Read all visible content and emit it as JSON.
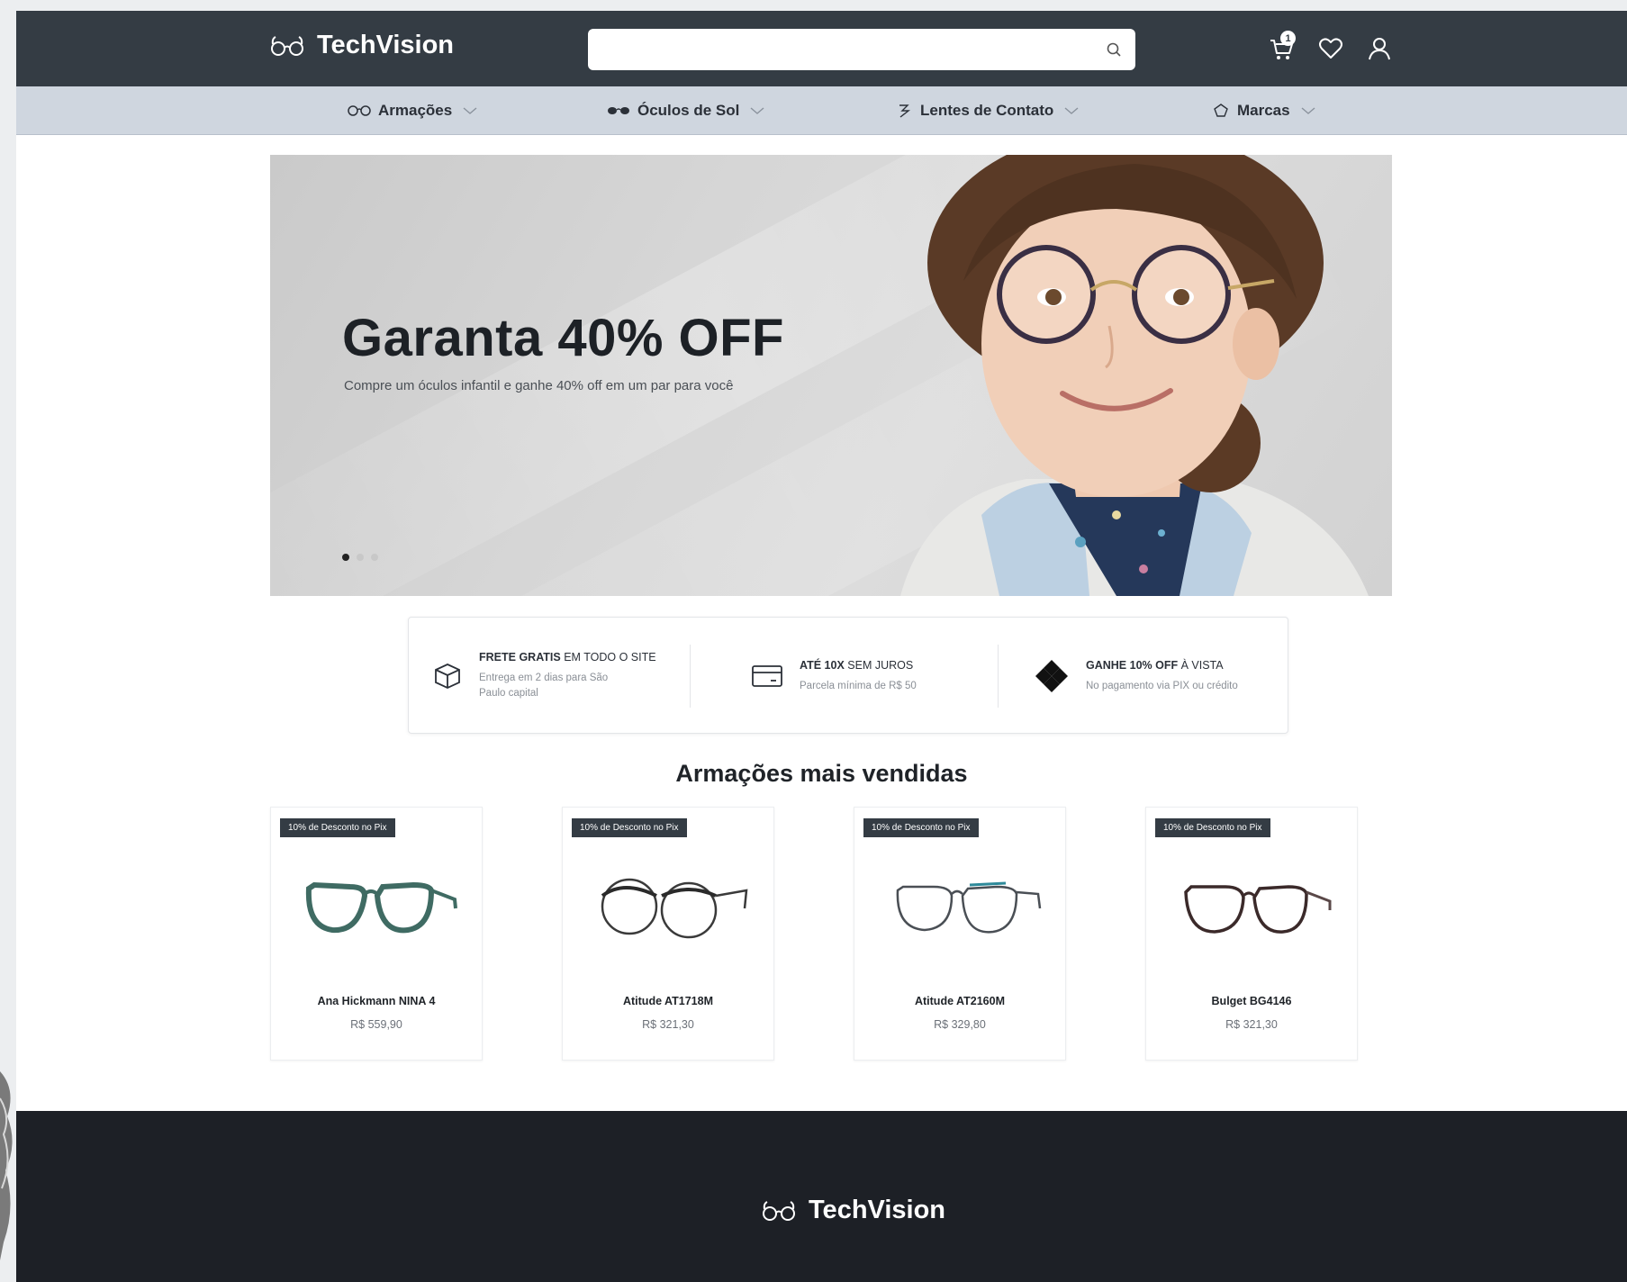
{
  "brand": {
    "name": "TechVision"
  },
  "search": {
    "placeholder": ""
  },
  "header": {
    "cart_count": "1"
  },
  "nav": {
    "items": [
      {
        "label": "Armações"
      },
      {
        "label": "Óculos de Sol"
      },
      {
        "label": "Lentes de Contato"
      },
      {
        "label": "Marcas"
      }
    ]
  },
  "banner": {
    "title": "Garanta 40% OFF",
    "subtitle": "Compre um óculos infantil e ganhe 40% off em um par para você",
    "slide_count": 3,
    "active_slide": 1
  },
  "benefits": [
    {
      "title_bold": "FRETE GRATIS",
      "title_rest": " EM TODO O SITE",
      "desc": "Entrega em 2 dias para São Paulo capital",
      "icon": "box-icon"
    },
    {
      "title_bold": "ATÉ 10X",
      "title_rest": " SEM JUROS",
      "desc": "Parcela mínima de R$ 50",
      "icon": "card-icon"
    },
    {
      "title_bold": "GANHE 10% OFF",
      "title_rest": " À VISTA",
      "desc": "No pagamento via PIX ou crédito",
      "icon": "pix-icon"
    }
  ],
  "products_section": {
    "title": "Armações mais vendidas"
  },
  "products": [
    {
      "badge": "10% de Desconto no Pix",
      "name": "Ana Hickmann NINA 4",
      "price": "R$ 559,90",
      "frame_color": "#3f6b63"
    },
    {
      "badge": "10% de Desconto no Pix",
      "name": "Atitude AT1718M",
      "price": "R$ 321,30",
      "frame_color": "#3a3a3a"
    },
    {
      "badge": "10% de Desconto no Pix",
      "name": "Atitude AT2160M",
      "price": "R$ 329,80",
      "frame_color": "#4a4f55"
    },
    {
      "badge": "10% de Desconto no Pix",
      "name": "Bulget BG4146",
      "price": "R$ 321,30",
      "frame_color": "#3b2a2a"
    }
  ],
  "footer": {
    "brand": "TechVision"
  },
  "colors": {
    "header": "#343c44",
    "nav": "#cfd6df",
    "footer": "#1d2026",
    "badge": "#343c44"
  }
}
